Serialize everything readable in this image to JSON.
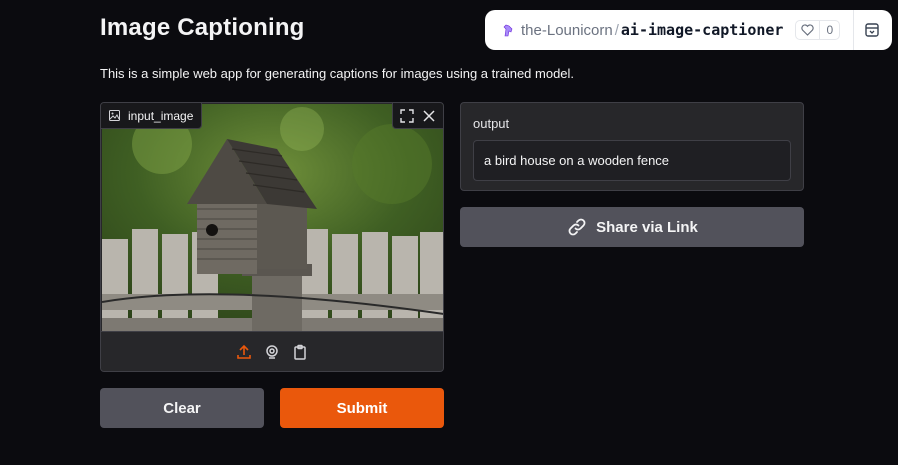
{
  "header": {
    "title": "Image Captioning",
    "description": "This is a simple web app for generating captions for images using a trained model."
  },
  "badge": {
    "owner": "the-Lounicorn",
    "separator": "/",
    "repo": "ai-image-captioner",
    "likes": "0"
  },
  "input_image": {
    "label": "input_image",
    "photo_subject": "bird house on fence"
  },
  "output": {
    "label": "output",
    "value": "a bird house on a wooden fence"
  },
  "buttons": {
    "share": "Share via Link",
    "clear": "Clear",
    "submit": "Submit"
  },
  "colors": {
    "accent": "#ea580c",
    "secondary_button": "#52525b",
    "background": "#0b0b0f"
  }
}
